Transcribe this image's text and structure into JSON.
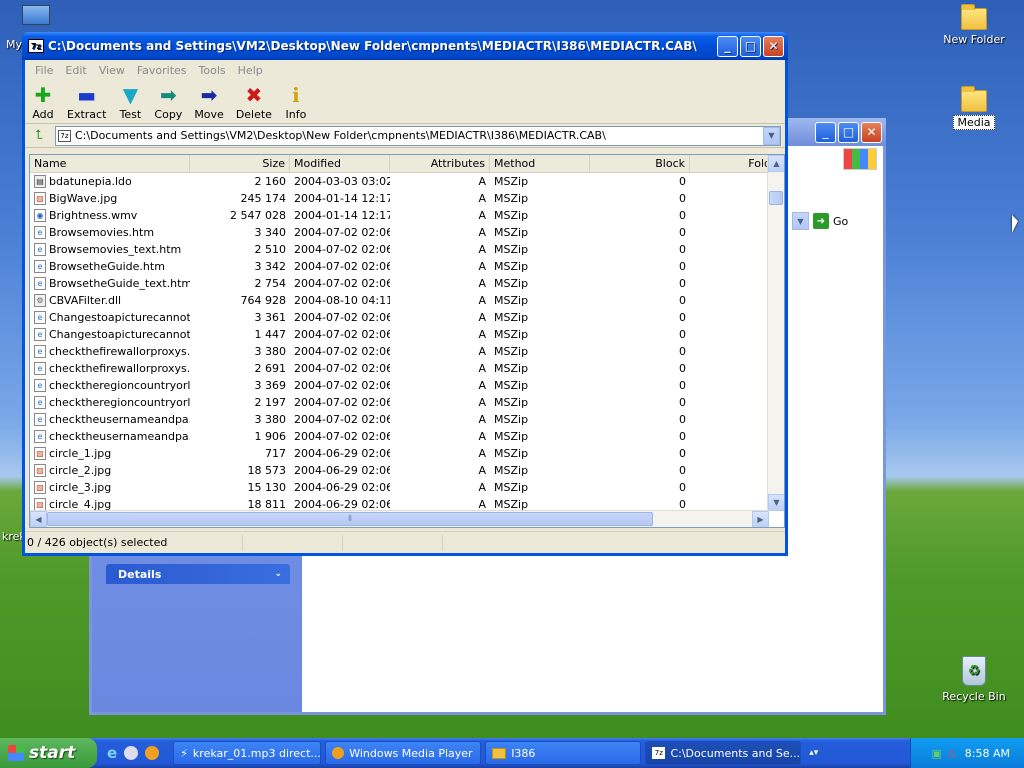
{
  "desktop": {
    "icons": [
      {
        "label": "New Folder"
      },
      {
        "label": "Media"
      },
      {
        "label": "Recycle Bin"
      }
    ],
    "left_partial_labels": [
      "My",
      "krek"
    ]
  },
  "background_window": {
    "details_label": "Details",
    "go_label": "Go"
  },
  "window": {
    "title": "C:\\Documents and Settings\\VM2\\Desktop\\New Folder\\cmpnents\\MEDIACTR\\I386\\MEDIACTR.CAB\\",
    "menu": [
      "File",
      "Edit",
      "View",
      "Favorites",
      "Tools",
      "Help"
    ],
    "toolbar": [
      {
        "label": "Add",
        "icon": "add-icon",
        "color": "#1aa81a"
      },
      {
        "label": "Extract",
        "icon": "extract-icon",
        "color": "#1a3ad0"
      },
      {
        "label": "Test",
        "icon": "test-icon",
        "color": "#18a8c8"
      },
      {
        "label": "Copy",
        "icon": "copy-icon",
        "color": "#1a8a7a"
      },
      {
        "label": "Move",
        "icon": "move-icon",
        "color": "#1a2aa0"
      },
      {
        "label": "Delete",
        "icon": "delete-icon",
        "color": "#d01818"
      },
      {
        "label": "Info",
        "icon": "info-icon",
        "color": "#d0a010"
      }
    ],
    "address": "C:\\Documents and Settings\\VM2\\Desktop\\New Folder\\cmpnents\\MEDIACTR\\I386\\MEDIACTR.CAB\\",
    "columns": [
      "Name",
      "Size",
      "Modified",
      "Attributes",
      "Method",
      "Block",
      "Fold"
    ],
    "files": [
      {
        "name": "bdatunepia.ldo",
        "size": "2 160",
        "modified": "2004-03-03 03:02",
        "attr": "A",
        "method": "MSZip",
        "block": "0",
        "icon": "file"
      },
      {
        "name": "BigWave.jpg",
        "size": "245 174",
        "modified": "2004-01-14 12:17",
        "attr": "A",
        "method": "MSZip",
        "block": "0",
        "icon": "image"
      },
      {
        "name": "Brightness.wmv",
        "size": "2 547 028",
        "modified": "2004-01-14 12:17",
        "attr": "A",
        "method": "MSZip",
        "block": "0",
        "icon": "media"
      },
      {
        "name": "Browsemovies.htm",
        "size": "3 340",
        "modified": "2004-07-02 02:06",
        "attr": "A",
        "method": "MSZip",
        "block": "0",
        "icon": "html"
      },
      {
        "name": "Browsemovies_text.htm",
        "size": "2 510",
        "modified": "2004-07-02 02:06",
        "attr": "A",
        "method": "MSZip",
        "block": "0",
        "icon": "html"
      },
      {
        "name": "BrowsetheGuide.htm",
        "size": "3 342",
        "modified": "2004-07-02 02:06",
        "attr": "A",
        "method": "MSZip",
        "block": "0",
        "icon": "html"
      },
      {
        "name": "BrowsetheGuide_text.htm",
        "size": "2 754",
        "modified": "2004-07-02 02:06",
        "attr": "A",
        "method": "MSZip",
        "block": "0",
        "icon": "html"
      },
      {
        "name": "CBVAFilter.dll",
        "size": "764 928",
        "modified": "2004-08-10 04:11",
        "attr": "A",
        "method": "MSZip",
        "block": "0",
        "icon": "dll"
      },
      {
        "name": "Changestoapicturecannot...",
        "size": "3 361",
        "modified": "2004-07-02 02:06",
        "attr": "A",
        "method": "MSZip",
        "block": "0",
        "icon": "html"
      },
      {
        "name": "Changestoapicturecannot...",
        "size": "1 447",
        "modified": "2004-07-02 02:06",
        "attr": "A",
        "method": "MSZip",
        "block": "0",
        "icon": "html"
      },
      {
        "name": "checkthefirewallorproxys...",
        "size": "3 380",
        "modified": "2004-07-02 02:06",
        "attr": "A",
        "method": "MSZip",
        "block": "0",
        "icon": "html"
      },
      {
        "name": "checkthefirewallorproxys...",
        "size": "2 691",
        "modified": "2004-07-02 02:06",
        "attr": "A",
        "method": "MSZip",
        "block": "0",
        "icon": "html"
      },
      {
        "name": "checktheregioncountryorl...",
        "size": "3 369",
        "modified": "2004-07-02 02:06",
        "attr": "A",
        "method": "MSZip",
        "block": "0",
        "icon": "html"
      },
      {
        "name": "checktheregioncountryorl...",
        "size": "2 197",
        "modified": "2004-07-02 02:06",
        "attr": "A",
        "method": "MSZip",
        "block": "0",
        "icon": "html"
      },
      {
        "name": "checktheusernameandpa...",
        "size": "3 380",
        "modified": "2004-07-02 02:06",
        "attr": "A",
        "method": "MSZip",
        "block": "0",
        "icon": "html"
      },
      {
        "name": "checktheusernameandpa...",
        "size": "1 906",
        "modified": "2004-07-02 02:06",
        "attr": "A",
        "method": "MSZip",
        "block": "0",
        "icon": "html"
      },
      {
        "name": "circle_1.jpg",
        "size": "717",
        "modified": "2004-06-29 02:06",
        "attr": "A",
        "method": "MSZip",
        "block": "0",
        "icon": "image"
      },
      {
        "name": "circle_2.jpg",
        "size": "18 573",
        "modified": "2004-06-29 02:06",
        "attr": "A",
        "method": "MSZip",
        "block": "0",
        "icon": "image"
      },
      {
        "name": "circle_3.jpg",
        "size": "15 130",
        "modified": "2004-06-29 02:06",
        "attr": "A",
        "method": "MSZip",
        "block": "0",
        "icon": "image"
      },
      {
        "name": "circle_4.jpg",
        "size": "18 811",
        "modified": "2004-06-29 02:06",
        "attr": "A",
        "method": "MSZip",
        "block": "0",
        "icon": "image"
      }
    ],
    "status": "0 / 426 object(s) selected"
  },
  "taskbar": {
    "start_label": "start",
    "tasks": [
      {
        "label": "krekar_01.mp3 direct...",
        "active": false
      },
      {
        "label": "Windows Media Player",
        "active": false
      },
      {
        "label": "I386",
        "active": false
      },
      {
        "label": "C:\\Documents and Se...",
        "active": true
      }
    ],
    "clock": "8:58 AM"
  }
}
